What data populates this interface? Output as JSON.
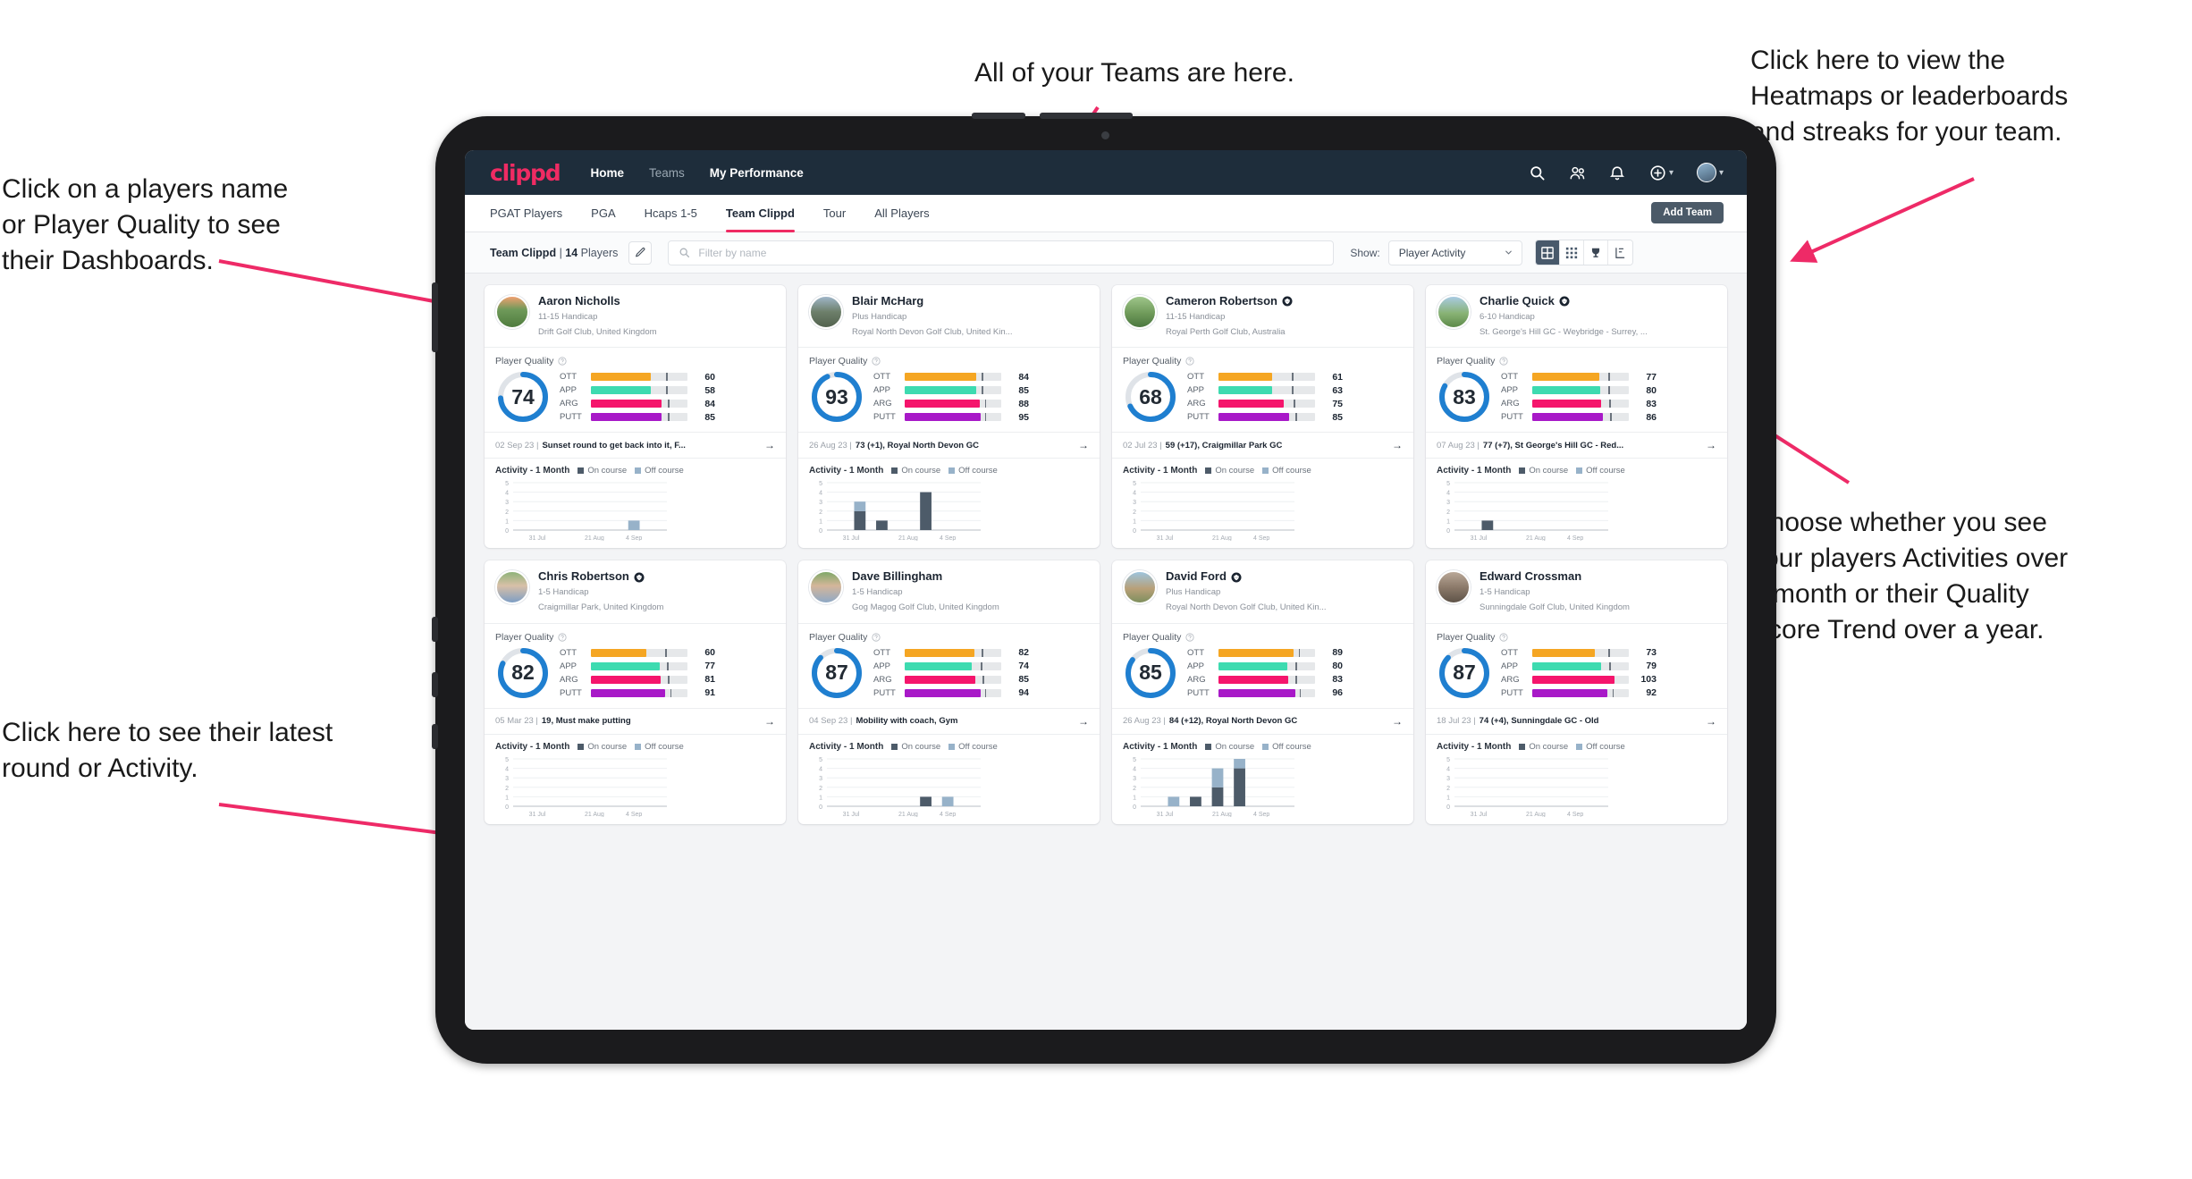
{
  "annotations": [
    {
      "id": "teams",
      "text": "All of your Teams are here."
    },
    {
      "id": "heatmaps",
      "text": "Click here to view the\nHeatmaps or leaderboards\nand streaks for your team."
    },
    {
      "id": "names",
      "text": "Click on a players name\nor Player Quality to see\ntheir Dashboards."
    },
    {
      "id": "choose",
      "text": "Choose whether you see\nyour players Activities over\na month or their Quality\nScore Trend over a year."
    },
    {
      "id": "latest",
      "text": "Click here to see their latest\nround or Activity."
    }
  ],
  "app": {
    "logo": "clippd",
    "nav": [
      {
        "label": "Home",
        "active": true
      },
      {
        "label": "Teams",
        "active": false
      },
      {
        "label": "My Performance",
        "active": true
      }
    ],
    "top_icons": [
      "search-icon",
      "people-icon",
      "bell-icon",
      "plus-circle-icon",
      "avatar"
    ],
    "subtabs": [
      {
        "label": "PGAT Players",
        "active": false
      },
      {
        "label": "PGA",
        "active": false
      },
      {
        "label": "Hcaps 1-5",
        "active": false
      },
      {
        "label": "Team Clippd",
        "active": true
      },
      {
        "label": "Tour",
        "active": false
      },
      {
        "label": "All Players",
        "active": false
      }
    ],
    "add_team_label": "Add Team",
    "toolbar": {
      "team_name": "Team Clippd",
      "separator": " | ",
      "player_count": "14",
      "players_word": " Players",
      "edit_icon": "pencil-icon",
      "search_placeholder": "Filter by name",
      "search_value": "",
      "show_label": "Show:",
      "show_value": "Player Activity",
      "view_buttons": [
        "grid-large-icon",
        "grid-small-icon",
        "trophy-icon",
        "chart-icon"
      ]
    }
  },
  "colors": {
    "accent": "#ef2b63",
    "topbar": "#1e2d3b",
    "ring": "#1f7fd0",
    "ring_track": "#dfe3e8",
    "ott": "#f5a623",
    "app": "#3ddbb0",
    "arg": "#f5156c",
    "putt": "#a819c8",
    "on_course": "#4d5b69",
    "off_course": "#97b2c9"
  },
  "card_labels": {
    "quality_title": "Player Quality",
    "metrics": [
      "OTT",
      "APP",
      "ARG",
      "PUTT"
    ],
    "activity_title": "Activity - 1 Month",
    "legend_on": "On course",
    "legend_off": "Off course",
    "y_ticks": [
      "5",
      "4",
      "3",
      "2",
      "1",
      "0"
    ],
    "x_ticks": [
      "31 Jul",
      "21 Aug",
      "4 Sep"
    ]
  },
  "players": [
    {
      "name": "Aaron Nicholls",
      "verified": false,
      "handicap": "11-15 Handicap",
      "club": "Drift Golf Club, United Kingdom",
      "quality": 74,
      "metrics": [
        {
          "label": "OTT",
          "value": 60,
          "fill": 62,
          "tick": 78
        },
        {
          "label": "APP",
          "value": 58,
          "fill": 62,
          "tick": 78
        },
        {
          "label": "ARG",
          "value": 84,
          "fill": 73,
          "tick": 80
        },
        {
          "label": "PUTT",
          "value": 85,
          "fill": 73,
          "tick": 80
        }
      ],
      "round_date": "02 Sep 23",
      "round_text": "Sunset round to get back into it, F...",
      "chart_data": {
        "type": "bar",
        "title": "Activity - 1 Month",
        "categories": [
          "31 Jul",
          "21 Aug",
          "4 Sep"
        ],
        "ylim": [
          0,
          5
        ],
        "series": [
          {
            "name": "On course",
            "values": [
              0,
              0,
              0,
              0,
              0,
              0,
              0
            ]
          },
          {
            "name": "Off course",
            "values": [
              0,
              0,
              0,
              0,
              0,
              1,
              0
            ]
          }
        ]
      }
    },
    {
      "name": "Blair McHarg",
      "verified": false,
      "handicap": "Plus Handicap",
      "club": "Royal North Devon Golf Club, United Kin...",
      "quality": 93,
      "metrics": [
        {
          "label": "OTT",
          "value": 84,
          "fill": 74,
          "tick": 80
        },
        {
          "label": "APP",
          "value": 85,
          "fill": 74,
          "tick": 80
        },
        {
          "label": "ARG",
          "value": 88,
          "fill": 78,
          "tick": 83
        },
        {
          "label": "PUTT",
          "value": 95,
          "fill": 79,
          "tick": 83
        }
      ],
      "round_date": "26 Aug 23",
      "round_text": "73 (+1), Royal North Devon GC",
      "chart_data": {
        "type": "bar",
        "title": "Activity - 1 Month",
        "categories": [
          "31 Jul",
          "21 Aug",
          "4 Sep"
        ],
        "ylim": [
          0,
          5
        ],
        "series": [
          {
            "name": "On course",
            "values": [
              0,
              2,
              1,
              0,
              4,
              0,
              0
            ]
          },
          {
            "name": "Off course",
            "values": [
              0,
              1,
              0,
              0,
              0,
              0,
              0
            ]
          }
        ]
      }
    },
    {
      "name": "Cameron Robertson",
      "verified": true,
      "handicap": "11-15 Handicap",
      "club": "Royal Perth Golf Club, Australia",
      "quality": 68,
      "metrics": [
        {
          "label": "OTT",
          "value": 61,
          "fill": 56,
          "tick": 76
        },
        {
          "label": "APP",
          "value": 63,
          "fill": 56,
          "tick": 76
        },
        {
          "label": "ARG",
          "value": 75,
          "fill": 68,
          "tick": 78
        },
        {
          "label": "PUTT",
          "value": 85,
          "fill": 73,
          "tick": 80
        }
      ],
      "round_date": "02 Jul 23",
      "round_text": "59 (+17), Craigmillar Park GC",
      "chart_data": {
        "type": "bar",
        "title": "Activity - 1 Month",
        "categories": [
          "31 Jul",
          "21 Aug",
          "4 Sep"
        ],
        "ylim": [
          0,
          5
        ],
        "series": [
          {
            "name": "On course",
            "values": [
              0,
              0,
              0,
              0,
              0,
              0,
              0
            ]
          },
          {
            "name": "Off course",
            "values": [
              0,
              0,
              0,
              0,
              0,
              0,
              0
            ]
          }
        ]
      }
    },
    {
      "name": "Charlie Quick",
      "verified": true,
      "handicap": "6-10 Handicap",
      "club": "St. George's Hill GC - Weybridge - Surrey, ...",
      "quality": 83,
      "metrics": [
        {
          "label": "OTT",
          "value": 77,
          "fill": 69,
          "tick": 79
        },
        {
          "label": "APP",
          "value": 80,
          "fill": 70,
          "tick": 79
        },
        {
          "label": "ARG",
          "value": 83,
          "fill": 71,
          "tick": 80
        },
        {
          "label": "PUTT",
          "value": 86,
          "fill": 73,
          "tick": 81
        }
      ],
      "round_date": "07 Aug 23",
      "round_text": "77 (+7), St George's Hill GC - Red...",
      "chart_data": {
        "type": "bar",
        "title": "Activity - 1 Month",
        "categories": [
          "31 Jul",
          "21 Aug",
          "4 Sep"
        ],
        "ylim": [
          0,
          5
        ],
        "series": [
          {
            "name": "On course",
            "values": [
              0,
              1,
              0,
              0,
              0,
              0,
              0
            ]
          },
          {
            "name": "Off course",
            "values": [
              0,
              0,
              0,
              0,
              0,
              0,
              0
            ]
          }
        ]
      }
    },
    {
      "name": "Chris Robertson",
      "verified": true,
      "handicap": "1-5 Handicap",
      "club": "Craigmillar Park, United Kingdom",
      "quality": 82,
      "metrics": [
        {
          "label": "OTT",
          "value": 60,
          "fill": 57,
          "tick": 77
        },
        {
          "label": "APP",
          "value": 77,
          "fill": 71,
          "tick": 79
        },
        {
          "label": "ARG",
          "value": 81,
          "fill": 72,
          "tick": 80
        },
        {
          "label": "PUTT",
          "value": 91,
          "fill": 77,
          "tick": 82
        }
      ],
      "round_date": "05 Mar 23",
      "round_text": "19, Must make putting",
      "chart_data": {
        "type": "bar",
        "title": "Activity - 1 Month",
        "categories": [
          "31 Jul",
          "21 Aug",
          "4 Sep"
        ],
        "ylim": [
          0,
          5
        ],
        "series": [
          {
            "name": "On course",
            "values": [
              0,
              0,
              0,
              0,
              0,
              0,
              0
            ]
          },
          {
            "name": "Off course",
            "values": [
              0,
              0,
              0,
              0,
              0,
              0,
              0
            ]
          }
        ]
      }
    },
    {
      "name": "Dave Billingham",
      "verified": false,
      "handicap": "1-5 Handicap",
      "club": "Gog Magog Golf Club, United Kingdom",
      "quality": 87,
      "metrics": [
        {
          "label": "OTT",
          "value": 82,
          "fill": 72,
          "tick": 80
        },
        {
          "label": "APP",
          "value": 74,
          "fill": 69,
          "tick": 79
        },
        {
          "label": "ARG",
          "value": 85,
          "fill": 73,
          "tick": 81
        },
        {
          "label": "PUTT",
          "value": 94,
          "fill": 79,
          "tick": 83
        }
      ],
      "round_date": "04 Sep 23",
      "round_text": "Mobility with coach, Gym",
      "chart_data": {
        "type": "bar",
        "title": "Activity - 1 Month",
        "categories": [
          "31 Jul",
          "21 Aug",
          "4 Sep"
        ],
        "ylim": [
          0,
          5
        ],
        "series": [
          {
            "name": "On course",
            "values": [
              0,
              0,
              0,
              0,
              1,
              0,
              0
            ]
          },
          {
            "name": "Off course",
            "values": [
              0,
              0,
              0,
              0,
              0,
              1,
              0
            ]
          }
        ]
      }
    },
    {
      "name": "David Ford",
      "verified": true,
      "handicap": "Plus Handicap",
      "club": "Royal North Devon Golf Club, United Kin...",
      "quality": 85,
      "metrics": [
        {
          "label": "OTT",
          "value": 89,
          "fill": 78,
          "tick": 83
        },
        {
          "label": "APP",
          "value": 80,
          "fill": 71,
          "tick": 80
        },
        {
          "label": "ARG",
          "value": 83,
          "fill": 72,
          "tick": 80
        },
        {
          "label": "PUTT",
          "value": 96,
          "fill": 80,
          "tick": 84
        }
      ],
      "round_date": "26 Aug 23",
      "round_text": "84 (+12), Royal North Devon GC",
      "chart_data": {
        "type": "bar",
        "title": "Activity - 1 Month",
        "categories": [
          "31 Jul",
          "21 Aug",
          "4 Sep"
        ],
        "ylim": [
          0,
          5
        ],
        "series": [
          {
            "name": "On course",
            "values": [
              0,
              0,
              1,
              2,
              4,
              0,
              0
            ]
          },
          {
            "name": "Off course",
            "values": [
              0,
              1,
              0,
              2,
              1,
              0,
              0
            ]
          }
        ]
      }
    },
    {
      "name": "Edward Crossman",
      "verified": false,
      "handicap": "1-5 Handicap",
      "club": "Sunningdale Golf Club, United Kingdom",
      "quality": 87,
      "metrics": [
        {
          "label": "OTT",
          "value": 73,
          "fill": 65,
          "tick": 79
        },
        {
          "label": "APP",
          "value": 79,
          "fill": 71,
          "tick": 80
        },
        {
          "label": "ARG",
          "value": 103,
          "fill": 85,
          "tick": 0
        },
        {
          "label": "PUTT",
          "value": 92,
          "fill": 78,
          "tick": 83
        }
      ],
      "round_date": "18 Jul 23",
      "round_text": "74 (+4), Sunningdale GC - Old",
      "chart_data": {
        "type": "bar",
        "title": "Activity - 1 Month",
        "categories": [
          "31 Jul",
          "21 Aug",
          "4 Sep"
        ],
        "ylim": [
          0,
          5
        ],
        "series": [
          {
            "name": "On course",
            "values": [
              0,
              0,
              0,
              0,
              0,
              0,
              0
            ]
          },
          {
            "name": "Off course",
            "values": [
              0,
              0,
              0,
              0,
              0,
              0,
              0
            ]
          }
        ]
      }
    }
  ]
}
